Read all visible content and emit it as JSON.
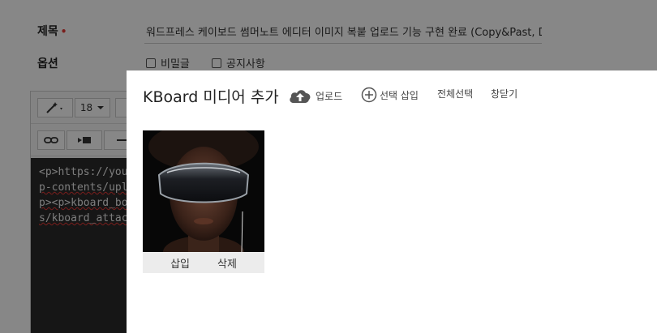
{
  "form": {
    "title_label": "제목",
    "required_mark": "•",
    "title_value": "워드프레스 케이보드 썸머노트 에디터 이미지 복붙 업로드 기능 구현 완료 (Copy&Past, Drag&",
    "options_label": "옵션",
    "options": [
      {
        "label": "비밀글",
        "checked": false
      },
      {
        "label": "공지사항",
        "checked": false
      }
    ]
  },
  "editor": {
    "font_size": "18",
    "code_lines": [
      "<p>https://you",
      "p-contents/upl",
      "p><p>kboard_bo",
      "s/kboard_attac"
    ]
  },
  "modal": {
    "title": "KBoard 미디어 추가",
    "actions": {
      "upload": "업로드",
      "insert_selected": "선택 삽입",
      "select_all": "전체선택",
      "close": "창닫기"
    },
    "media_items": [
      {
        "alt": "Person wearing a VR headset",
        "insert_label": "삽입",
        "delete_label": "삭제"
      }
    ]
  },
  "colors": {
    "required": "#e53935",
    "overlay": "rgba(0,0,0,0.47)",
    "code_bg": "#2b2b2b"
  }
}
